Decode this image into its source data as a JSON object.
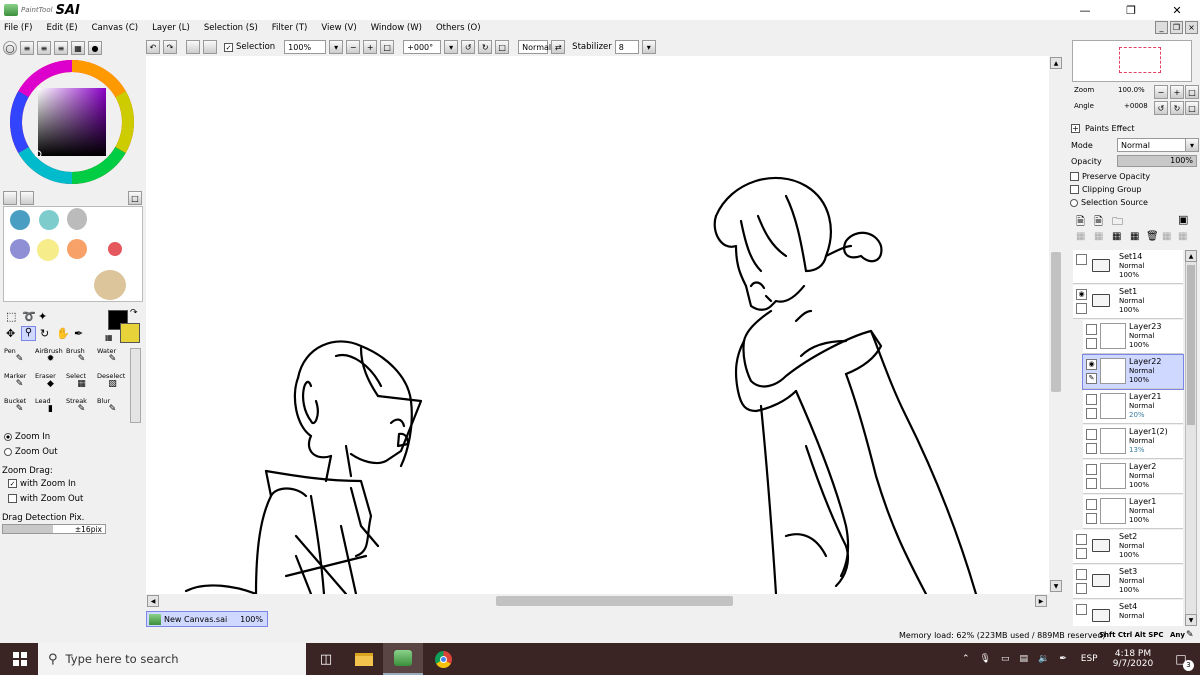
{
  "app": {
    "brand_small": "PaintTool",
    "brand_big": "SAI"
  },
  "menu": [
    "File (F)",
    "Edit (E)",
    "Canvas (C)",
    "Layer (L)",
    "Selection (S)",
    "Filter (T)",
    "View (V)",
    "Window (W)",
    "Others (O)"
  ],
  "toolbar": {
    "selection_label": "Selection",
    "zoom": "100%",
    "angle": "+000°",
    "blend": "Normal",
    "stabilizer_label": "Stabilizer",
    "stabilizer_value": "8"
  },
  "left": {
    "tools": [
      {
        "label": "Pen"
      },
      {
        "label": "AirBrush"
      },
      {
        "label": "Brush"
      },
      {
        "label": "Water"
      },
      {
        "label": "Marker"
      },
      {
        "label": "Eraser"
      },
      {
        "label": "Select"
      },
      {
        "label": "Deselect"
      },
      {
        "label": "Bucket"
      },
      {
        "label": "Lead"
      },
      {
        "label": "Streak"
      },
      {
        "label": "Blur"
      }
    ],
    "zoom_in": "Zoom In",
    "zoom_out": "Zoom Out",
    "zoom_drag": "Zoom Drag:",
    "with_zoom_in": "with Zoom In",
    "with_zoom_out": "with Zoom Out",
    "drag_detection": "Drag Detection Pix.",
    "drag_value": "±16pix",
    "swatch_colors": [
      "#4a9ec2",
      "#7fcccc",
      "#bbbbbb",
      "#8f8fd6",
      "#f6ec8a",
      "#f7a067",
      "#e4585e",
      "#dcc59a"
    ],
    "fg_color": "#000000",
    "bg_color": "#e8d23a"
  },
  "navigator": {
    "zoom_label": "Zoom",
    "zoom_value": "100.0%",
    "angle_label": "Angle",
    "angle_value": "+0008"
  },
  "layer_props": {
    "paints_effect": "Paints Effect",
    "mode_label": "Mode",
    "mode_value": "Normal",
    "opacity_label": "Opacity",
    "opacity_value": "100%",
    "preserve_opacity": "Preserve Opacity",
    "clipping_group": "Clipping Group",
    "selection_source": "Selection Source"
  },
  "layers": [
    {
      "name": "Set14",
      "mode": "Normal",
      "opacity": "100%"
    },
    {
      "name": "Set1",
      "mode": "Normal",
      "opacity": "100%"
    },
    {
      "name": "Layer23",
      "mode": "Normal",
      "opacity": "100%"
    },
    {
      "name": "Layer22",
      "mode": "Normal",
      "opacity": "100%"
    },
    {
      "name": "Layer21",
      "mode": "Normal",
      "opacity": "20%"
    },
    {
      "name": "Layer1(2)",
      "mode": "Normal",
      "opacity": "13%"
    },
    {
      "name": "Layer2",
      "mode": "Normal",
      "opacity": "100%"
    },
    {
      "name": "Layer1",
      "mode": "Normal",
      "opacity": "100%"
    },
    {
      "name": "Set2",
      "mode": "Normal",
      "opacity": "100%"
    },
    {
      "name": "Set3",
      "mode": "Normal",
      "opacity": "100%"
    },
    {
      "name": "Set4",
      "mode": "Normal",
      "opacity": ""
    }
  ],
  "canvas_tab": {
    "name": "New Canvas.sai",
    "zoom": "100%"
  },
  "status": {
    "memory": "Memory load: 62% (223MB used / 889MB reserved)",
    "keys": "Shft Ctrl Alt SPC",
    "any": "Any"
  },
  "taskbar": {
    "search_placeholder": "Type here to search",
    "lang": "ESP",
    "time": "4:18 PM",
    "date": "9/7/2020",
    "notif_count": "3"
  }
}
